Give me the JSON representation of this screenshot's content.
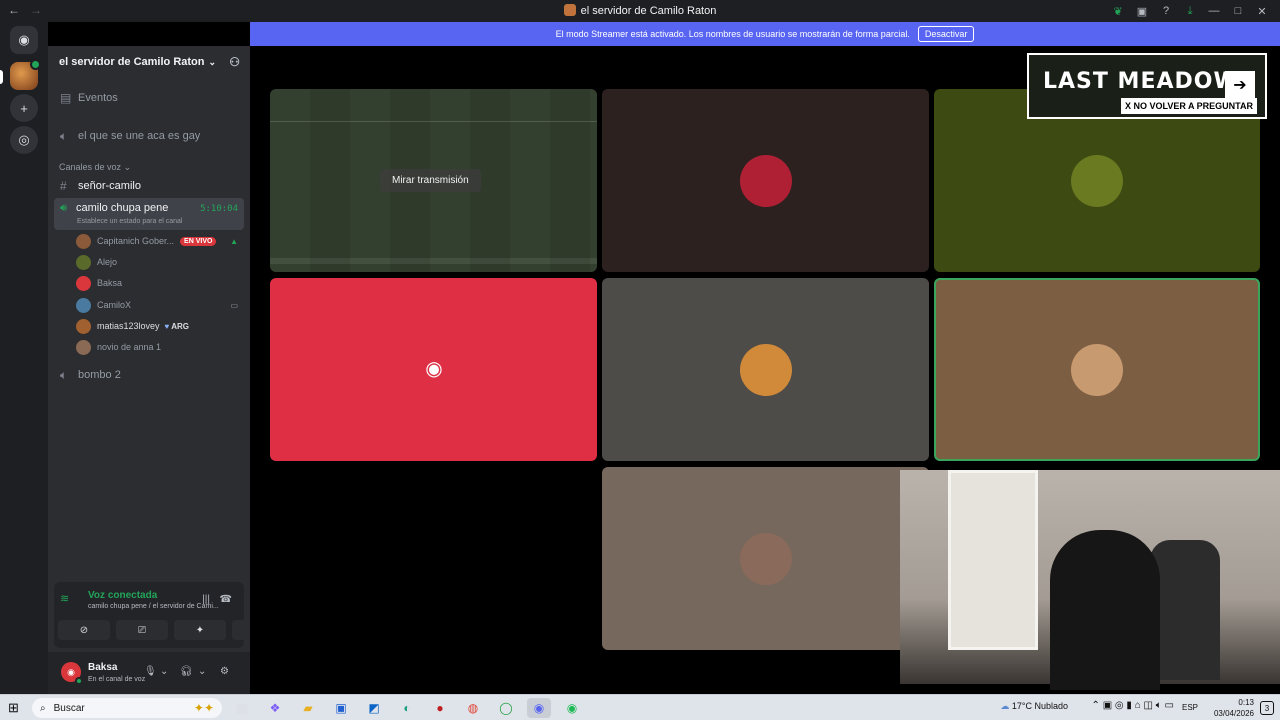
{
  "window": {
    "title": "el servidor de Camilo Raton"
  },
  "banner": {
    "text": "El modo Streamer está activado. Los nombres de usuario se mostrarán de forma parcial.",
    "button": "Desactivar"
  },
  "sidebar": {
    "server_name": "el servidor de Camilo Raton",
    "events": "Eventos",
    "voice_top": "el que se une aca es gay",
    "voice_category": "Canales de voz",
    "text_channel": "señor-camilo",
    "active_channel": {
      "name": "camilo chupa pene",
      "timer": "5:10:04",
      "status": "Establece un estado para el canal"
    },
    "members": [
      {
        "name": "Capitanich Gober...",
        "badge": "EN VIVO",
        "color": "#8a5a3a"
      },
      {
        "name": "Alejo",
        "color": "#5a6a2a"
      },
      {
        "name": "Baksa",
        "color": "#da373c"
      },
      {
        "name": "CamiloX",
        "color": "#4a7aa0"
      },
      {
        "name": "matias123lovey",
        "tag": "ARG",
        "color": "#a06030"
      },
      {
        "name": "novio de anna 1",
        "color": "#8a6a55"
      }
    ],
    "voice_bottom": "bombo 2"
  },
  "voice_panel": {
    "title": "Voz conectada",
    "subtitle": "camilo chupa pene / el servidor de Cami..."
  },
  "user_panel": {
    "name": "Baksa",
    "status": "En el canal de voz"
  },
  "stage": {
    "watch_label": "Mirar transmisión",
    "ad_logo": "LAST MEADOW",
    "ad_dismiss": "X NO VOLVER A PREGUNTAR",
    "tiles": [
      {
        "kind": "stream",
        "bg": "#2f3a2b"
      },
      {
        "kind": "avatar",
        "bg": "#2d2120",
        "avatar": "#b02035"
      },
      {
        "kind": "avatar",
        "bg": "#3d4a12",
        "avatar": "#6a7a20"
      },
      {
        "kind": "discord",
        "bg": "#de2f45"
      },
      {
        "kind": "avatar",
        "bg": "#4e4c48",
        "avatar": "#d08a3a"
      },
      {
        "kind": "avatar",
        "bg": "#7c5e43",
        "avatar": "#c89a70"
      },
      {
        "kind": "avatar",
        "bg": "#77685e",
        "avatar": "#8a6a5a"
      }
    ]
  },
  "taskbar": {
    "search_placeholder": "Buscar",
    "weather": "17°C  Nublado",
    "lang": "ESP",
    "time": "0:13",
    "date": "03/04/2026",
    "notif": "3"
  },
  "colors": {
    "accent": "#5865f2",
    "online": "#23a559",
    "live": "#da373c"
  }
}
